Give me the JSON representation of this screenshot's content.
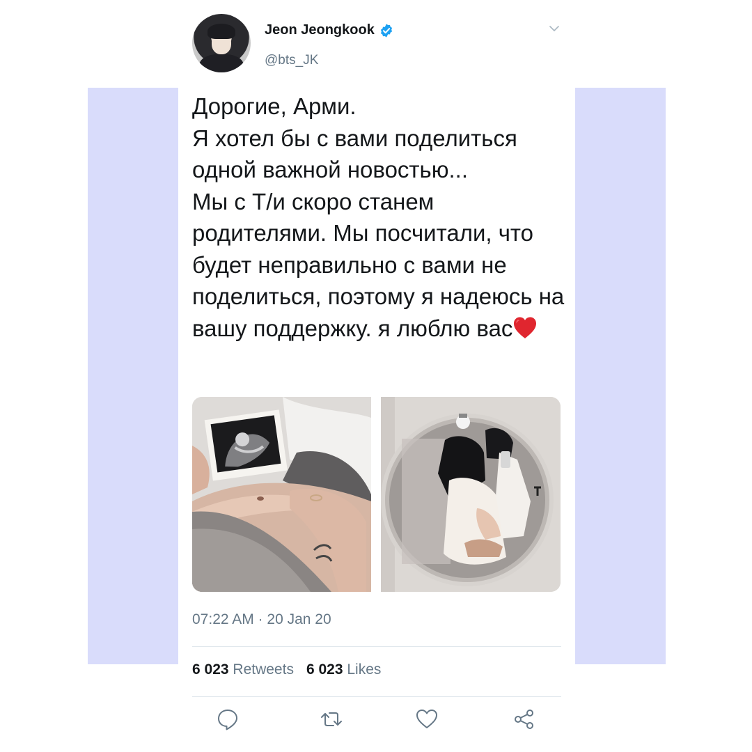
{
  "user": {
    "display_name": "Jeon Jeongkook",
    "handle": "@bts_JK",
    "verified": true
  },
  "tweet": {
    "text": "Дорогие, Арми.\nЯ хотел бы с вами поделиться одной важной новостью...\nМы с Т/и скоро станем родителями. Мы посчитали, что будет неправильно с вами не поделиться, поэтому я надеюсь на вашу поддержку. я люблю вас",
    "emoji": "red-heart",
    "timestamp": "07:22 AM · 20 Jan 20",
    "retweets_count": "6 023",
    "retweets_label": "Retweets",
    "likes_count": "6 023",
    "likes_label": "Likes"
  },
  "photos": [
    {
      "description": "ultrasound-and-belly-photo"
    },
    {
      "description": "mirror-selfie-couple-photo"
    }
  ],
  "icons": {
    "reply": "reply-icon",
    "retweet": "retweet-icon",
    "like": "like-icon",
    "share": "share-icon",
    "menu": "chevron-down-icon"
  },
  "colors": {
    "text": "#14171a",
    "secondary": "#657786",
    "verified": "#1da1f2",
    "background_band": "#d9dcfb"
  }
}
